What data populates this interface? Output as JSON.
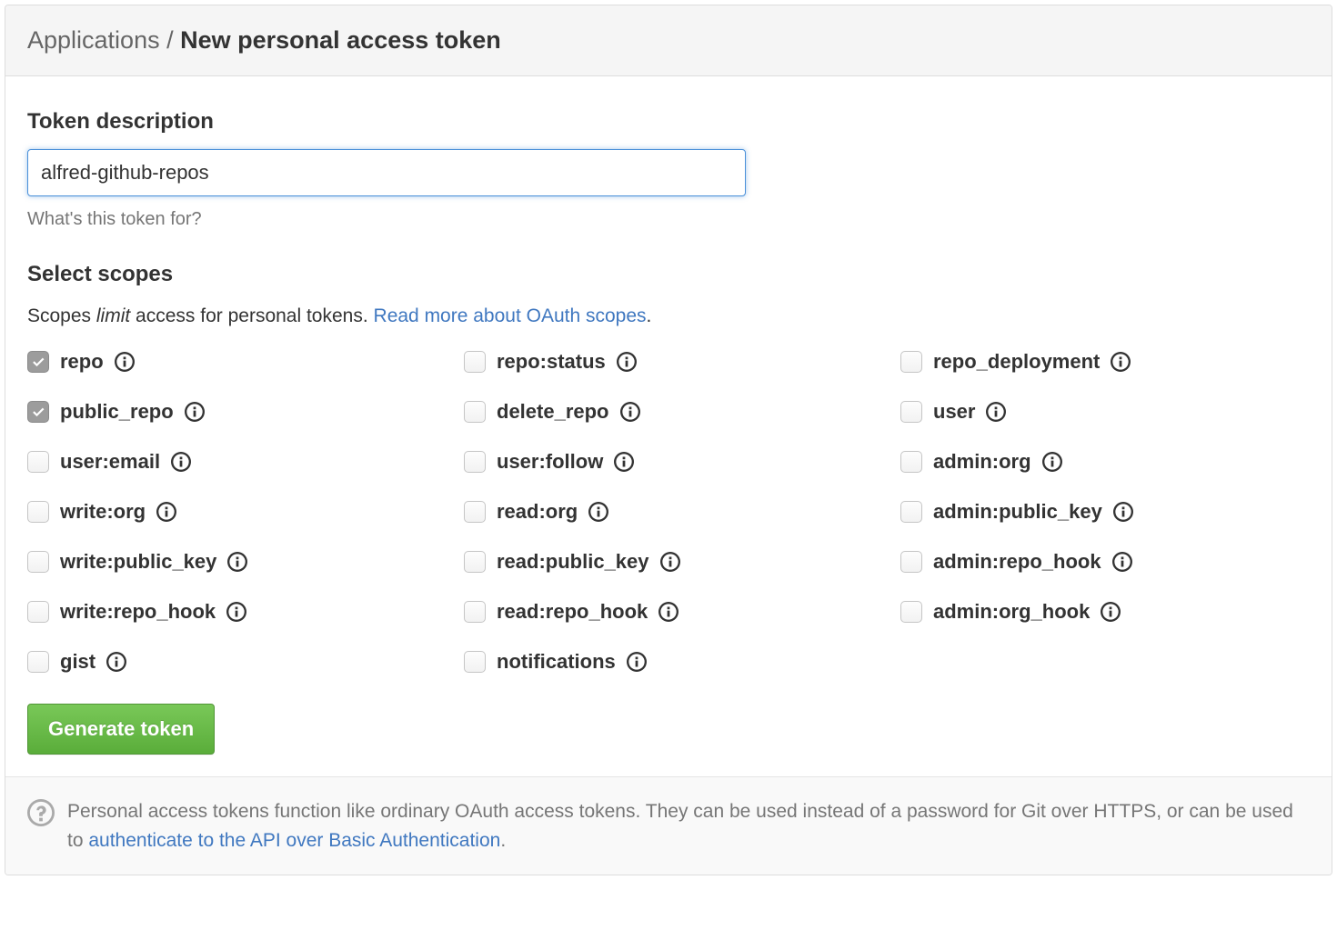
{
  "breadcrumb": {
    "parent": "Applications",
    "separator": " / ",
    "current": "New personal access token"
  },
  "token": {
    "label": "Token description",
    "value": "alfred-github-repos",
    "hint": "What's this token for?"
  },
  "scopes_section": {
    "label": "Select scopes",
    "desc_prefix": "Scopes ",
    "desc_em": "limit",
    "desc_rest": " access for personal tokens. ",
    "desc_link": "Read more about OAuth scopes",
    "desc_period": "."
  },
  "scopes": [
    {
      "name": "repo",
      "checked": true
    },
    {
      "name": "repo:status",
      "checked": false
    },
    {
      "name": "repo_deployment",
      "checked": false
    },
    {
      "name": "public_repo",
      "checked": true
    },
    {
      "name": "delete_repo",
      "checked": false
    },
    {
      "name": "user",
      "checked": false
    },
    {
      "name": "user:email",
      "checked": false
    },
    {
      "name": "user:follow",
      "checked": false
    },
    {
      "name": "admin:org",
      "checked": false
    },
    {
      "name": "write:org",
      "checked": false
    },
    {
      "name": "read:org",
      "checked": false
    },
    {
      "name": "admin:public_key",
      "checked": false
    },
    {
      "name": "write:public_key",
      "checked": false
    },
    {
      "name": "read:public_key",
      "checked": false
    },
    {
      "name": "admin:repo_hook",
      "checked": false
    },
    {
      "name": "write:repo_hook",
      "checked": false
    },
    {
      "name": "read:repo_hook",
      "checked": false
    },
    {
      "name": "admin:org_hook",
      "checked": false
    },
    {
      "name": "gist",
      "checked": false
    },
    {
      "name": "notifications",
      "checked": false
    }
  ],
  "generate_label": "Generate token",
  "footer": {
    "text_a": "Personal access tokens function like ordinary OAuth access tokens. They can be used instead of a password for Git over HTTPS, or can be used to ",
    "link": "authenticate to the API over Basic Authentication",
    "text_b": "."
  }
}
